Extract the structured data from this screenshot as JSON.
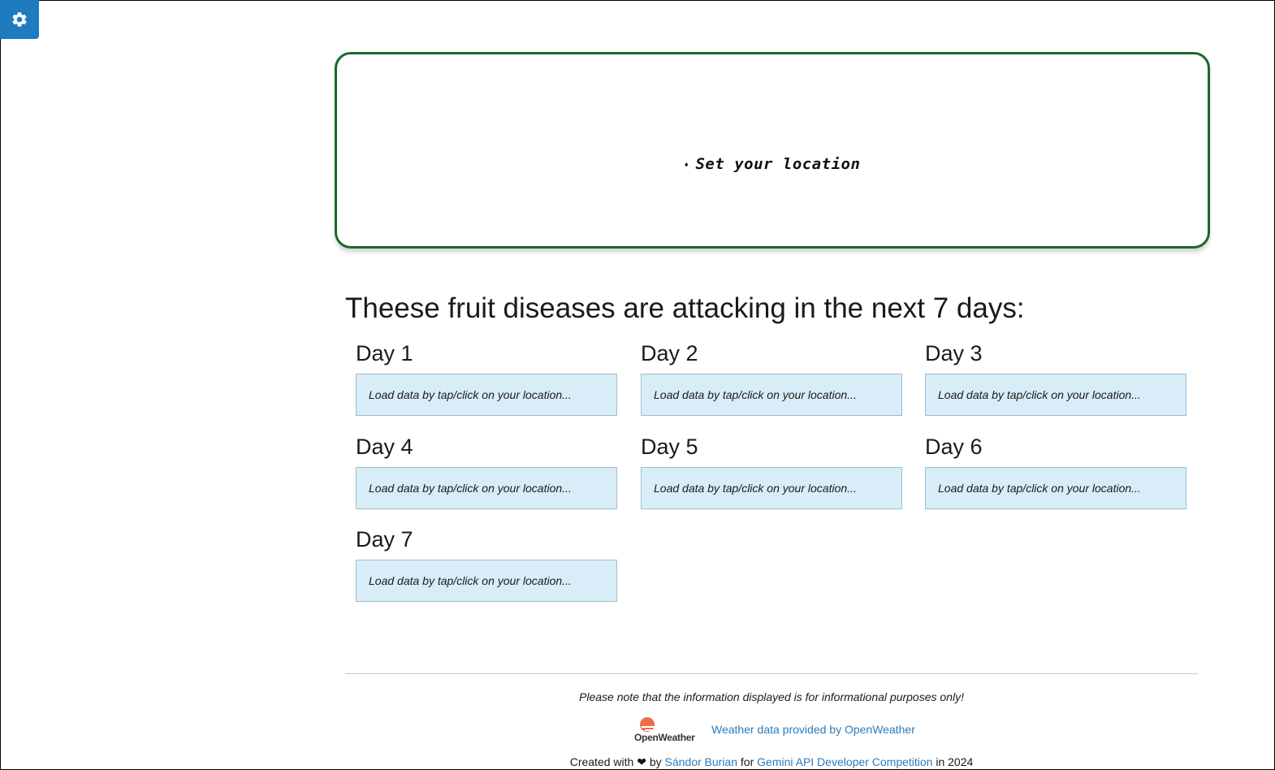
{
  "settings": {
    "icon": "gear-icon",
    "color": "#1f7bbf"
  },
  "location": {
    "label": "Set your location",
    "icon": "pin-icon",
    "border_color": "#16692c"
  },
  "heading": "Theese fruit diseases are attacking in the next 7 days:",
  "days": [
    {
      "title": "Day 1",
      "message": "Load data by tap/click on your location..."
    },
    {
      "title": "Day 2",
      "message": "Load data by tap/click on your location..."
    },
    {
      "title": "Day 3",
      "message": "Load data by tap/click on your location..."
    },
    {
      "title": "Day 4",
      "message": "Load data by tap/click on your location..."
    },
    {
      "title": "Day 5",
      "message": "Load data by tap/click on your location..."
    },
    {
      "title": "Day 6",
      "message": "Load data by tap/click on your location..."
    },
    {
      "title": "Day 7",
      "message": "Load data by tap/click on your location..."
    }
  ],
  "footer": {
    "note": "Please note that the information displayed is for informational purposes only!",
    "openweather_logo_text": "OpenWeather",
    "openweather_link": "Weather data provided by OpenWeather",
    "created_with": "Created with",
    "by": "by",
    "author": "Sándor Burian",
    "for": "for",
    "competition": "Gemini API Developer Competition",
    "year_text": "in 2024"
  },
  "colors": {
    "card_bg": "#d9edf8",
    "link": "#2a7bbd"
  }
}
